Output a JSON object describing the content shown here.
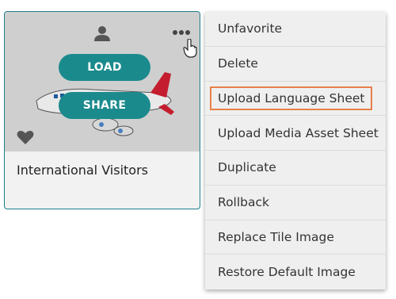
{
  "tile": {
    "title": "International Visitors",
    "load_label": "LOAD",
    "share_label": "SHARE",
    "icons": {
      "owner": "user-icon",
      "more": "ellipsis-icon",
      "favorite": "heart-icon",
      "cursor": "hand-pointer-icon"
    },
    "accent_color": "#1b8a8d",
    "border_color": "#1a7f8a"
  },
  "menu": {
    "items": [
      {
        "label": "Unfavorite"
      },
      {
        "label": "Delete"
      },
      {
        "label": "Upload Language Sheet",
        "highlighted": true
      },
      {
        "label": "Upload Media Asset Sheet"
      },
      {
        "label": "Duplicate"
      },
      {
        "label": "Rollback"
      },
      {
        "label": "Replace Tile Image"
      },
      {
        "label": "Restore Default Image"
      }
    ],
    "highlight_color": "#e8804a"
  }
}
